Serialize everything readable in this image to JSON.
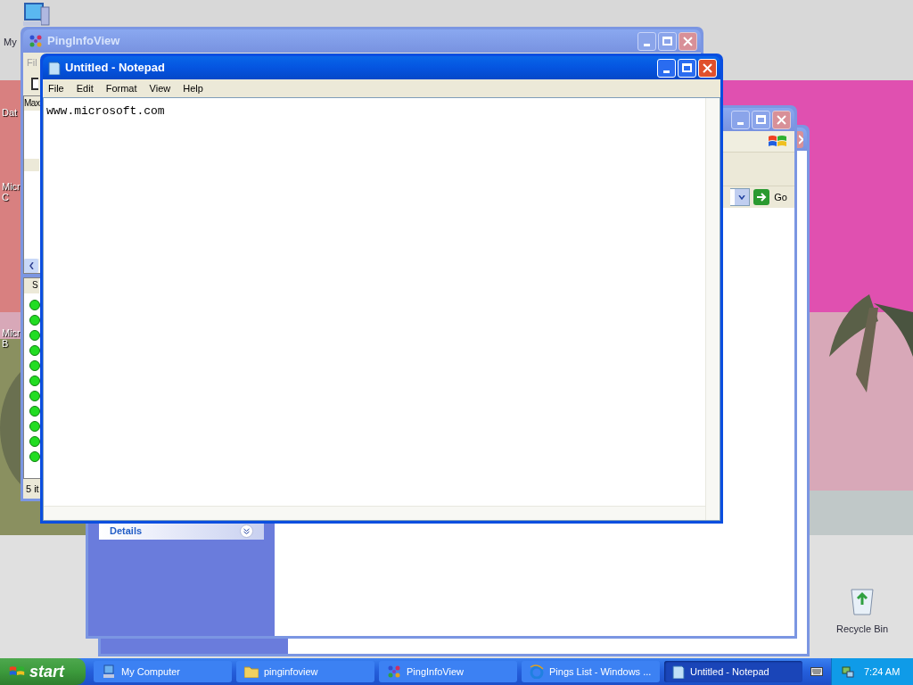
{
  "desktop_icons": [
    {
      "kind": "computer",
      "lines": [
        "My"
      ]
    },
    {
      "kind": "none",
      "lines": [
        "Dat"
      ]
    },
    {
      "kind": "none",
      "lines": [
        "Micr",
        "C"
      ]
    },
    {
      "kind": "none",
      "lines": [
        "Micr",
        "B"
      ]
    },
    {
      "kind": "recycle",
      "lines": [
        "Recycle Bin"
      ]
    }
  ],
  "back_window": {
    "active": false
  },
  "explorer_window": {
    "active": false,
    "go_label": "Go",
    "task_section": "Details"
  },
  "pinginfoview_window": {
    "title": "PingInfoView",
    "active": false,
    "menu": [
      "Fil"
    ],
    "column_header": "Max",
    "list_header": "S",
    "status": "5 it",
    "rows": [
      {
        "color": "#22dd22"
      },
      {
        "color": "#22dd22"
      },
      {
        "color": "#22dd22"
      },
      {
        "color": "#22dd22"
      },
      {
        "color": "#22dd22"
      },
      {
        "color": "#22dd22"
      },
      {
        "color": "#22dd22"
      },
      {
        "color": "#22dd22"
      },
      {
        "color": "#22dd22"
      },
      {
        "color": "#22dd22"
      },
      {
        "color": "#22dd22"
      }
    ]
  },
  "notepad_window": {
    "title": "Untitled - Notepad",
    "active": true,
    "menu": [
      "File",
      "Edit",
      "Format",
      "View",
      "Help"
    ],
    "text": "www.microsoft.com"
  },
  "taskbar": {
    "start_label": "start",
    "buttons": [
      {
        "kind": "computer",
        "label": "My Computer",
        "selected": false
      },
      {
        "kind": "folder",
        "label": "pinginfoview",
        "selected": false
      },
      {
        "kind": "ping",
        "label": "PingInfoView",
        "selected": false
      },
      {
        "kind": "browser",
        "label": "Pings List - Windows ...",
        "selected": false
      },
      {
        "kind": "notepad",
        "label": "Untitled - Notepad",
        "selected": true
      }
    ],
    "clock": "7:24 AM"
  }
}
